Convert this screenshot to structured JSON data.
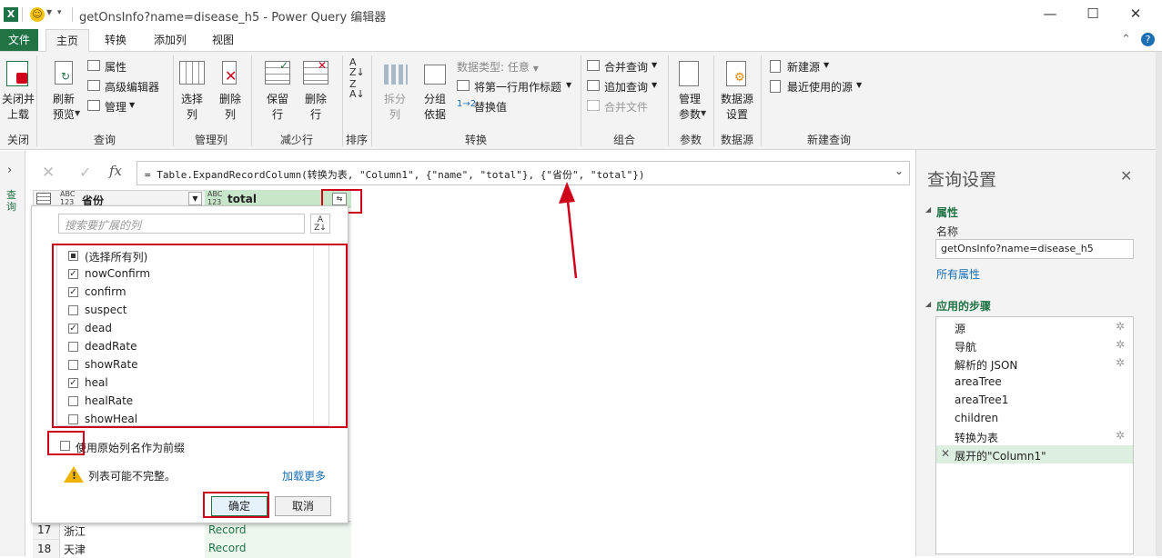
{
  "window": {
    "title": "getOnsInfo?name=disease_h5 - Power Query 编辑器",
    "minimize": "—",
    "maximize": "☐",
    "close": "✕"
  },
  "tabs": [
    "文件",
    "主页",
    "转换",
    "添加列",
    "视图"
  ],
  "ribbon": {
    "close_group": {
      "btn": "关闭并\n上载",
      "label": "关闭"
    },
    "query_group": {
      "refresh": "刷新\n预览",
      "properties": "属性",
      "advanced": "高级编辑器",
      "manage": "管理",
      "label": "查询"
    },
    "manage_cols": {
      "select": "选择\n列",
      "remove": "删除\n列",
      "label": "管理列"
    },
    "reduce_rows": {
      "keep": "保留\n行",
      "remove": "删除\n行",
      "label": "减少行"
    },
    "sort": {
      "label": "排序"
    },
    "transform": {
      "split": "拆分\n列",
      "group": "分组\n依据",
      "datatype": "数据类型: 任意",
      "first_row": "将第一行用作标题",
      "replace": "替换值",
      "label": "转换"
    },
    "combine": {
      "merge": "合并查询",
      "append": "追加查询",
      "combine_files": "合并文件",
      "label": "组合"
    },
    "params": {
      "manage": "管理\n参数",
      "label": "参数"
    },
    "datasource": {
      "settings": "数据源\n设置",
      "label": "数据源"
    },
    "new_query": {
      "new_source": "新建源",
      "recent": "最近使用的源",
      "label": "新建查询"
    }
  },
  "formula": {
    "fx": "fx",
    "text": "= Table.ExpandRecordColumn(转换为表, \"Column1\", {\"name\", \"total\"}, {\"省份\", \"total\"})"
  },
  "sidebar": {
    "label": "查询"
  },
  "grid": {
    "col1": {
      "type": "ABC\n123",
      "name": "省份"
    },
    "col2": {
      "type": "ABC\n123",
      "name": "total"
    },
    "rows": [
      {
        "n": "17",
        "name": "浙江",
        "value": "Record"
      },
      {
        "n": "18",
        "name": "天津",
        "value": "Record"
      }
    ]
  },
  "expand_panel": {
    "search_placeholder": "搜索要扩展的列",
    "items": [
      {
        "label": "(选择所有列)",
        "state": "partial"
      },
      {
        "label": "nowConfirm",
        "state": "checked"
      },
      {
        "label": "confirm",
        "state": "checked"
      },
      {
        "label": "suspect",
        "state": "unchecked"
      },
      {
        "label": "dead",
        "state": "checked"
      },
      {
        "label": "deadRate",
        "state": "unchecked"
      },
      {
        "label": "showRate",
        "state": "unchecked"
      },
      {
        "label": "heal",
        "state": "checked"
      },
      {
        "label": "healRate",
        "state": "unchecked"
      },
      {
        "label": "showHeal",
        "state": "unchecked"
      }
    ],
    "prefix_label": "使用原始列名作为前缀",
    "warning": "列表可能不完整。",
    "load_more": "加载更多",
    "ok": "确定",
    "cancel": "取消"
  },
  "settings": {
    "title": "查询设置",
    "properties_heading": "属性",
    "name_label": "名称",
    "name_value": "getOnsInfo?name=disease_h5",
    "all_properties": "所有属性",
    "steps_heading": "应用的步骤",
    "steps": [
      {
        "label": "源",
        "gear": true
      },
      {
        "label": "导航",
        "gear": true
      },
      {
        "label": "解析的 JSON",
        "gear": true
      },
      {
        "label": "areaTree",
        "gear": false
      },
      {
        "label": "areaTree1",
        "gear": false
      },
      {
        "label": "children",
        "gear": false
      },
      {
        "label": "转换为表",
        "gear": true
      },
      {
        "label": "展开的\"Column1\"",
        "gear": false
      }
    ]
  },
  "colors": {
    "excel_green": "#217346",
    "annotation_red": "#d0021b",
    "link_blue": "#1a6fb5",
    "selected_step": "#dcefe0"
  }
}
